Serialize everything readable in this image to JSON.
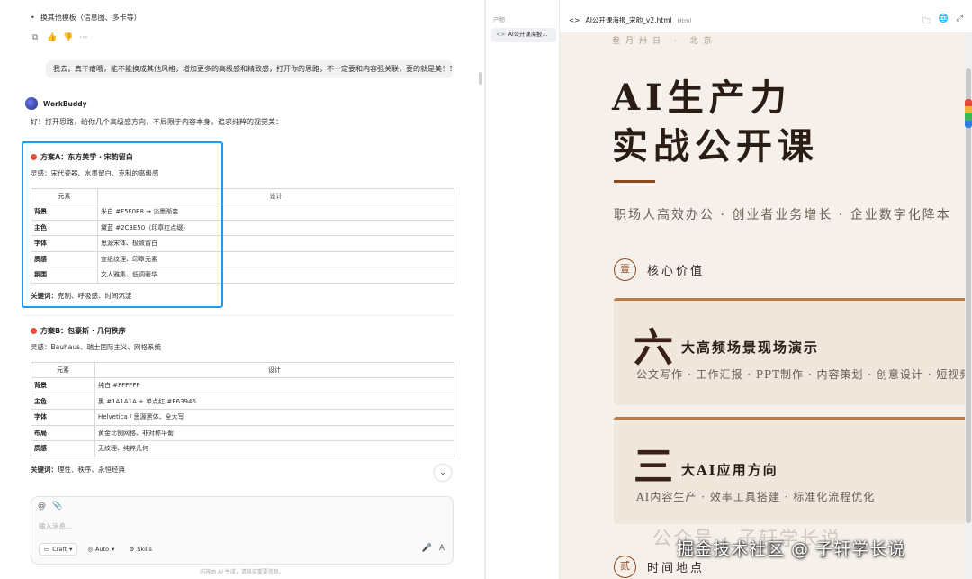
{
  "chat": {
    "bullet_text": "换其他模板（信息图、多卡等）",
    "msg_actions": [
      "⧉",
      "👍",
      "👎",
      "⋯"
    ],
    "user_message": "我去，真干瘪哦，能不能换成其他风格，增加更多的高级感和精致感，打开你的思路，不一定要和内容强关联，要的就是美！！！",
    "bot_name": "WorkBuddy",
    "bot_intro": "好！打开思路，给你几个高级感方向，不局限于内容本身，追求纯粹的视觉美：",
    "scheme_a": {
      "title": "方案A：东方美学 · 宋韵留白",
      "inspiration": "灵感：宋代瓷器、水墨留白、克制的高级感",
      "col_element": "元素",
      "col_design": "设计",
      "rows": [
        {
          "k": "背景",
          "v": "米白 #F5F0E8 → 淡墨渐变"
        },
        {
          "k": "主色",
          "v": "黛蓝 #2C3E50（印章红点缀）"
        },
        {
          "k": "字体",
          "v": "思源宋体、极致留白"
        },
        {
          "k": "质感",
          "v": "宣纸纹理、印章元素"
        },
        {
          "k": "氛围",
          "v": "文人雅集、低调奢华"
        }
      ],
      "keywords_label": "关键词：",
      "keywords": "克制、呼吸感、时间沉淀"
    },
    "scheme_b": {
      "title": "方案B：包豪斯 · 几何秩序",
      "inspiration": "灵感：Bauhaus、瑞士国际主义、网格系统",
      "col_element": "元素",
      "col_design": "设计",
      "rows": [
        {
          "k": "背景",
          "v": "纯白 #FFFFFF"
        },
        {
          "k": "主色",
          "v": "黑 #1A1A1A + 单点红 #E63946"
        },
        {
          "k": "字体",
          "v": "Helvetica / 思源黑体、全大写"
        },
        {
          "k": "布局",
          "v": "黄金比例网格、非对称平衡"
        },
        {
          "k": "质感",
          "v": "无纹理、纯粹几何"
        }
      ],
      "keywords_label": "关键词：",
      "keywords": "理性、秩序、永恒经典"
    },
    "scroll_down": "⌄",
    "composer": {
      "icons": [
        "@",
        "📎"
      ],
      "placeholder": "输入消息...",
      "mode_label": "Craft",
      "model_label": "Auto",
      "skills_label": "Skills",
      "mic": "🎤",
      "send": "A"
    },
    "footer_note": "内容由 AI 生成，请核实重要信息。"
  },
  "files": {
    "header": "产物",
    "item_icon": "<>",
    "item_label": "AI公开课海报..."
  },
  "preview": {
    "file_icon": "<>",
    "file_name": "AI公开课海报_宋韵_v2.html",
    "file_type": "Html",
    "tools": [
      "🗀",
      "🌐",
      "⤢"
    ],
    "poster": {
      "date": "叁月卅日 · 北京",
      "title_line1": "AI生产力",
      "title_line2": "实战公开课",
      "subtitle": "职场人高效办公 · 创业者业务增长 · 企业数字化降本",
      "section1_num": "壹",
      "section1_label": "核心价值",
      "card1_big": "六",
      "card1_title": "大高频场景现场演示",
      "card1_desc": "公文写作 · 工作汇报 · PPT制作 · 内容策划 · 创意设计 · 短视频脚",
      "card2_big": "三",
      "card2_title": "大AI应用方向",
      "card2_desc": "AI内容生产 · 效率工具搭建 · 标准化流程优化",
      "section2_num": "贰",
      "section2_label": "时间地点"
    },
    "watermark_light": "公众号 · 子轩学长说",
    "watermark_main": "掘金技术社区 @ 子轩学长说"
  },
  "colors": {
    "highlight_border": "#1e9bf0",
    "poster_bg": "#f6f0ea",
    "accent_brown": "#8a4a20",
    "card_bg": "#efe6dc"
  }
}
